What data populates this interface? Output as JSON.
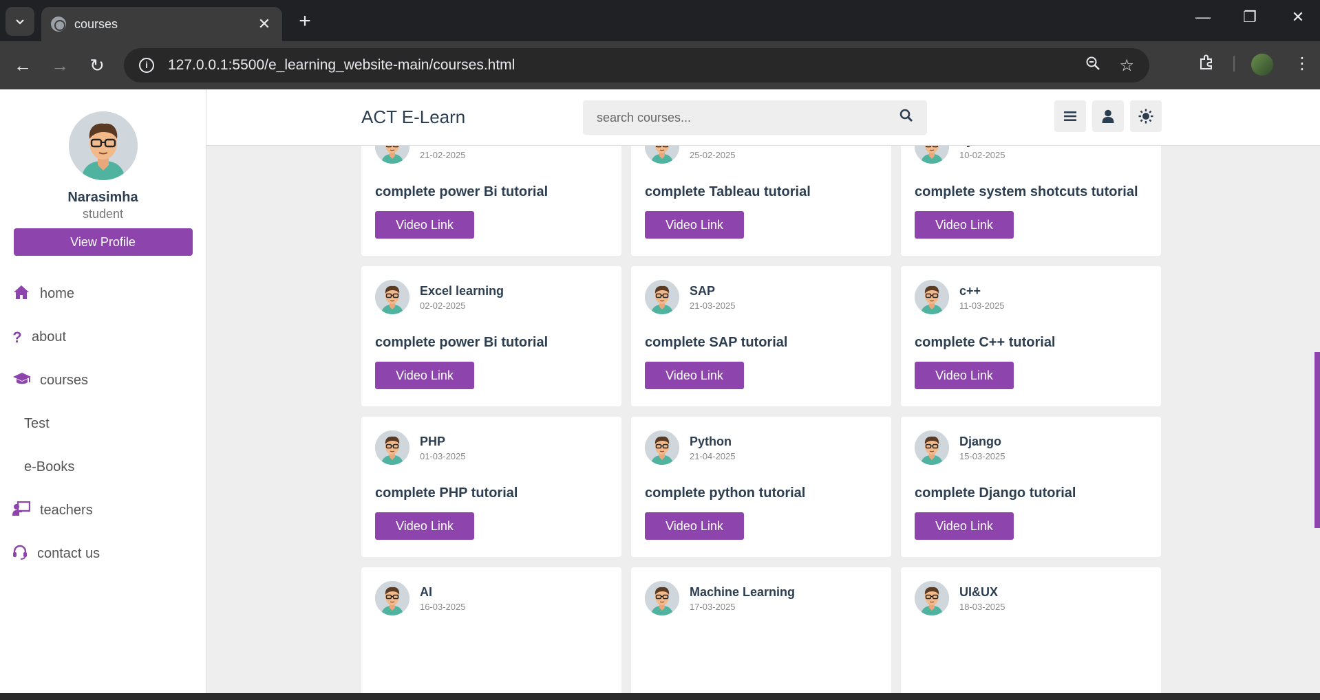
{
  "browser": {
    "tab_title": "courses",
    "url_host": "127.0.0.1",
    "url_path": ":5500/e_learning_website-main/courses.html"
  },
  "header": {
    "logo": "ACT E-Learn",
    "search_placeholder": "search courses..."
  },
  "sidebar": {
    "name": "Narasimha",
    "role": "student",
    "view_profile": "View Profile",
    "items": [
      {
        "label": "home",
        "icon": "home-icon"
      },
      {
        "label": "about",
        "icon": "question-icon"
      },
      {
        "label": "courses",
        "icon": "graduation-cap-icon"
      },
      {
        "label": "Test",
        "icon": ""
      },
      {
        "label": "e-Books",
        "icon": ""
      },
      {
        "label": "teachers",
        "icon": "chalkboard-teacher-icon"
      },
      {
        "label": "contact us",
        "icon": "headset-icon"
      }
    ]
  },
  "video_label": "Video Link",
  "courses": [
    {
      "title": "PowerBi",
      "date": "21-02-2025",
      "desc": "complete power Bi tutorial"
    },
    {
      "title": "Tableau",
      "date": "25-02-2025",
      "desc": "complete Tableau tutorial"
    },
    {
      "title": "system shotcuts",
      "date": "10-02-2025",
      "desc": "complete system shotcuts tutorial"
    },
    {
      "title": "Excel learning",
      "date": "02-02-2025",
      "desc": "complete power Bi tutorial"
    },
    {
      "title": "SAP",
      "date": "21-03-2025",
      "desc": "complete SAP tutorial"
    },
    {
      "title": "c++",
      "date": "11-03-2025",
      "desc": "complete C++ tutorial"
    },
    {
      "title": "PHP",
      "date": "01-03-2025",
      "desc": "complete PHP tutorial"
    },
    {
      "title": "Python",
      "date": "21-04-2025",
      "desc": "complete python tutorial"
    },
    {
      "title": "Django",
      "date": "15-03-2025",
      "desc": "complete Django tutorial"
    },
    {
      "title": "AI",
      "date": "16-03-2025",
      "desc": ""
    },
    {
      "title": "Machine Learning",
      "date": "17-03-2025",
      "desc": ""
    },
    {
      "title": "UI&UX",
      "date": "18-03-2025",
      "desc": ""
    }
  ],
  "colors": {
    "accent": "#8e44ad",
    "text": "#2c3e50",
    "page_bg": "#eeeeee"
  }
}
